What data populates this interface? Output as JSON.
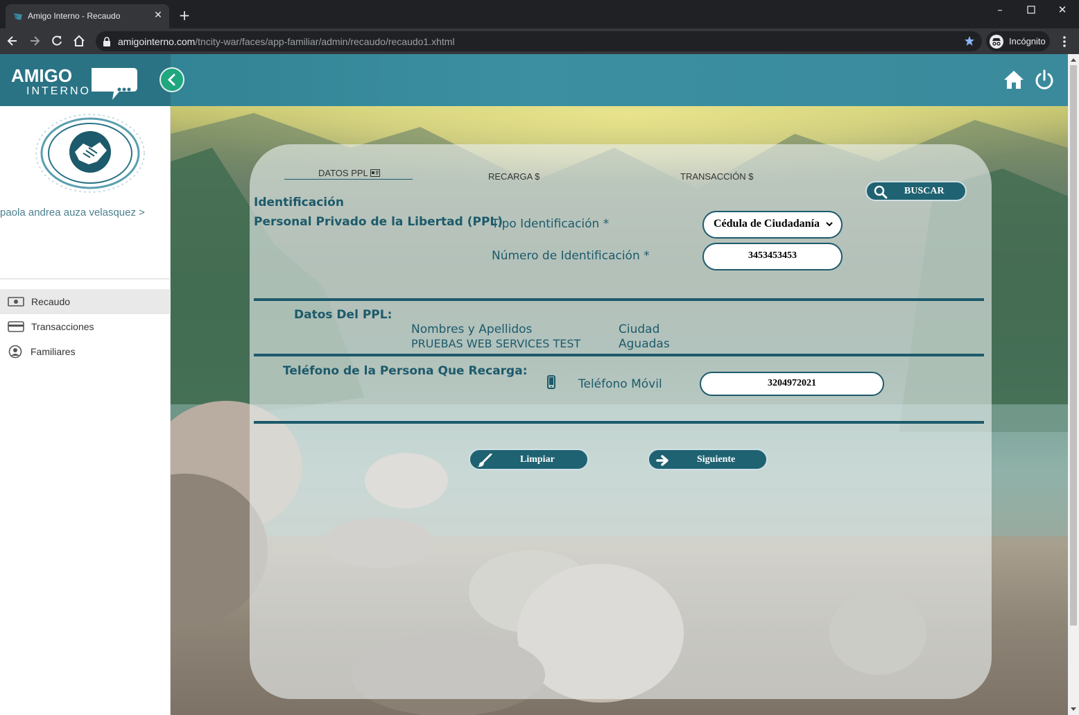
{
  "browser": {
    "tab_title": "Amigo Interno - Recaudo",
    "url_host": "amigointerno.com",
    "url_path": "/tncity-war/faces/app-familiar/admin/recaudo/recaudo1.xhtml",
    "incognito_label": "Incógnito"
  },
  "app": {
    "logo_text_top": "AMIGO",
    "logo_text_bottom": "INTERNO"
  },
  "sidebar": {
    "user_name": "paola andrea auza velasquez >",
    "items": [
      {
        "label": "Recaudo",
        "icon": "money-icon",
        "active": true
      },
      {
        "label": "Transacciones",
        "icon": "credit-card-icon",
        "active": false
      },
      {
        "label": "Familiares",
        "icon": "user-circle-icon",
        "active": false
      }
    ]
  },
  "tabs": {
    "datos": "DATOS PPL",
    "recarga": "RECARGA $",
    "transaccion": "TRANSACCIÓN $"
  },
  "buttons": {
    "buscar": "BUSCAR",
    "limpiar": "Limpiar",
    "siguiente": "Siguiente"
  },
  "identificacion": {
    "title": "Identificación",
    "subtitle": "Personal Privado de la Libertad (PPL)",
    "tipo_label": "Tipo Identificación *",
    "tipo_value": "Cédula de Ciudadanía",
    "numero_label": "Número de Identificación *",
    "numero_value": "3453453453"
  },
  "datos_ppl": {
    "title": "Datos Del PPL:",
    "nombres_label": "Nombres y Apellidos",
    "nombres_value": "PRUEBAS WEB SERVICES TEST",
    "ciudad_label": "Ciudad",
    "ciudad_value": "Aguadas"
  },
  "telefono": {
    "title": "Teléfono de la Persona Que Recarga:",
    "movil_label": "Teléfono Móvil",
    "movil_value": "3204972021"
  },
  "colors": {
    "primary": "#1d5a6b",
    "topbar": "#3b8fa0",
    "accent_green": "#1fa77f"
  }
}
